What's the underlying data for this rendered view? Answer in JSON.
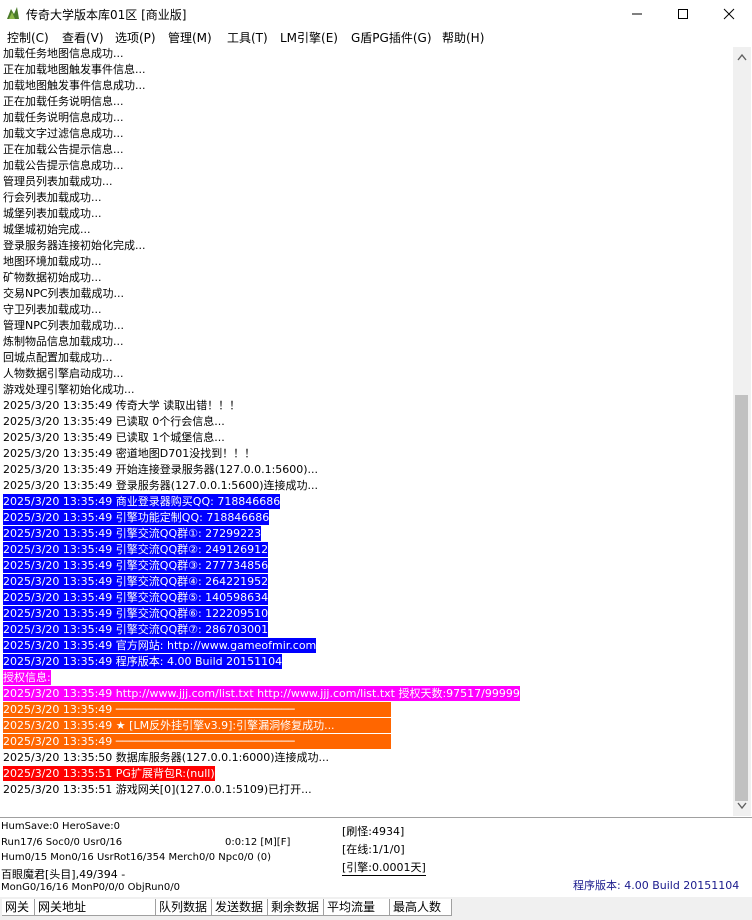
{
  "window": {
    "title": "传奇大学版本库01区 [商业版]",
    "minimize_glyph": "—",
    "maximize_glyph": "□",
    "close_glyph": "✕"
  },
  "menu": [
    "控制(C)",
    "查看(V)",
    "选项(P)",
    "管理(M)",
    "工具(T)",
    "LM引擎(E)",
    "G盾PG插件(G)",
    "帮助(H)"
  ],
  "log_plain_top": [
    "加载任务地图信息成功...",
    "正在加载地图触发事件信息...",
    "加载地图触发事件信息成功...",
    "正在加载任务说明信息...",
    "加载任务说明信息成功...",
    "加载文字过滤信息成功...",
    "正在加载公告提示信息...",
    "加载公告提示信息成功...",
    "管理员列表加载成功...",
    "行会列表加载成功...",
    "城堡列表加载成功...",
    "城堡城初始完成...",
    "登录服务器连接初始化完成...",
    "地图环境加载成功...",
    "矿物数据初始成功...",
    "交易NPC列表加载成功...",
    "守卫列表加载成功...",
    "管理NPC列表加载成功...",
    "炼制物品信息加载成功...",
    "回城点配置加载成功...",
    "人物数据引擎启动成功...",
    "游戏处理引擎初始化成功...",
    "2025/3/20 13:35:49 传奇大学 读取出错！！！",
    "2025/3/20 13:35:49 已读取 0个行会信息...",
    "2025/3/20 13:35:49 已读取 1个城堡信息...",
    "2025/3/20 13:35:49 密道地图D701没找到！！！",
    "2025/3/20 13:35:49 开始连接登录服务器(127.0.0.1:5600)...",
    "2025/3/20 13:35:49 登录服务器(127.0.0.1:5600)连接成功..."
  ],
  "log_blue": [
    "2025/3/20 13:35:49 商业登录器购买QQ: 718846686",
    "2025/3/20 13:35:49 引擎功能定制QQ: 718846686",
    "2025/3/20 13:35:49 引擎交流QQ群①: 27299223",
    "2025/3/20 13:35:49 引擎交流QQ群②: 249126912",
    "2025/3/20 13:35:49 引擎交流QQ群③: 277734856",
    "2025/3/20 13:35:49 引擎交流QQ群④: 264221952",
    "2025/3/20 13:35:49 引擎交流QQ群⑤: 140598634",
    "2025/3/20 13:35:49 引擎交流QQ群⑥: 122209510",
    "2025/3/20 13:35:49 引擎交流QQ群⑦: 286703001",
    "2025/3/20 13:35:49 官方网站: http://www.gameofmir.com",
    "2025/3/20 13:35:49 程序版本: 4.00 Build 20151104"
  ],
  "log_magenta": [
    "授权信息:",
    "2025/3/20 13:35:49 http://www.jjj.com/list.txt http://www.jjj.com/list.txt 授权天数:97517/99999"
  ],
  "log_orange": [
    "2025/3/20 13:35:49 ───────────────────────────",
    "2025/3/20 13:35:49 ★ [LM反外挂引擎v3.9]:引擎漏洞修复成功...",
    "2025/3/20 13:35:49 ───────────────────────────"
  ],
  "log_after_orange": "2025/3/20 13:35:50 数据库服务器(127.0.0.1:6000)连接成功...",
  "log_red": "2025/3/20 13:35:51 PG扩展背包R:(null)",
  "log_last": "2025/3/20 13:35:51 游戏网关[0](127.0.0.1:5109)已打开...",
  "status": {
    "line1": "HumSave:0 HeroSave:0",
    "line2": "Run17/6 Soc0/0 Usr0/16",
    "timer": "0:0:12 [M][F]",
    "line3": "Hum0/15 Mon0/16 UsrRot16/354 Merch0/0 Npc0/0 (0)",
    "line4": "百眼魔君[头目],49/394 -",
    "line5": "MonG0/16/16 MonP0/0/0 ObjRun0/0",
    "refresh": "[刷怪:4934]",
    "online": "[在线:1/1/0]",
    "engine": "[引擎:0.0001天]",
    "version": "程序版本: 4.00 Build 20151104"
  },
  "columns": [
    "网关",
    "网关地址",
    "队列数据",
    "发送数据",
    "剩余数据",
    "平均流量",
    "最高人数"
  ],
  "colors": {
    "blue": "#0000ff",
    "magenta": "#ff00ff",
    "orange": "#ff6600",
    "red": "#ff0000"
  }
}
